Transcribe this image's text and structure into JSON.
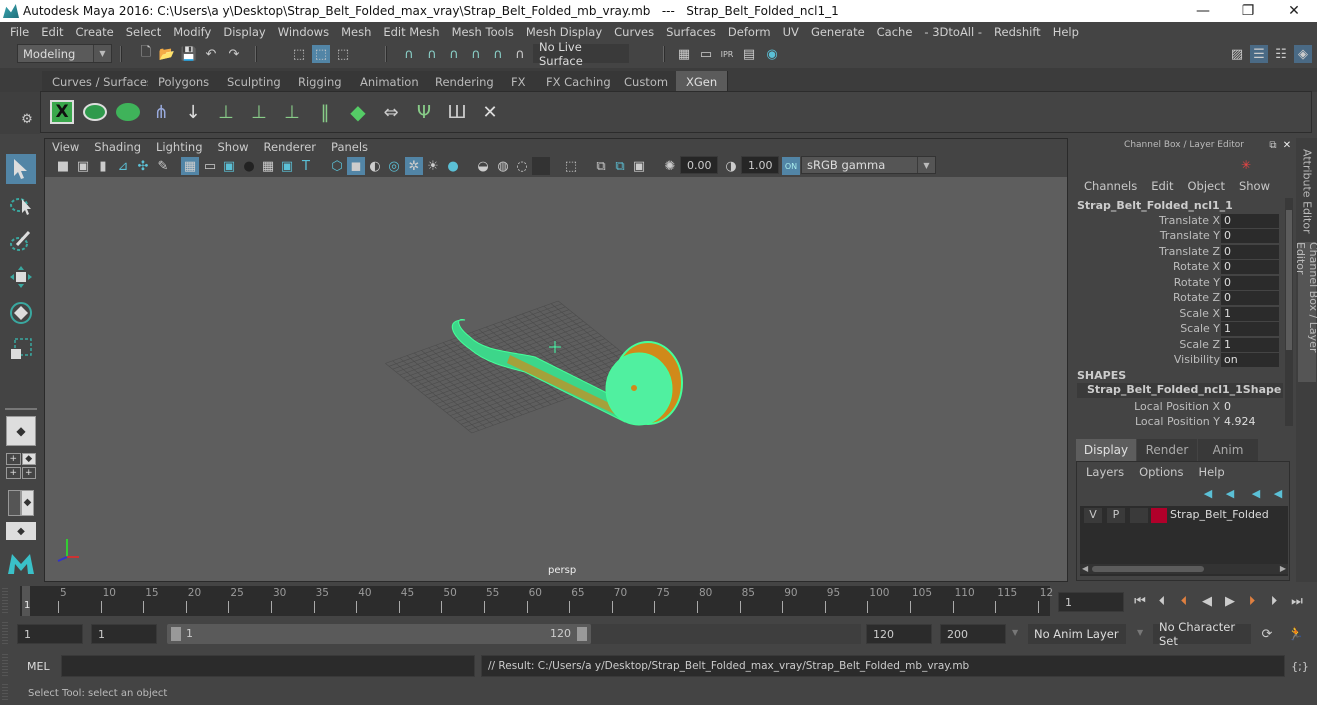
{
  "window": {
    "title": "Autodesk Maya 2016: C:\\Users\\a y\\Desktop\\Strap_Belt_Folded_max_vray\\Strap_Belt_Folded_mb_vray.mb   ---   Strap_Belt_Folded_ncl1_1",
    "minimize": "—",
    "maximize": "❐",
    "close": "✕"
  },
  "menubar": [
    "File",
    "Edit",
    "Create",
    "Select",
    "Modify",
    "Display",
    "Windows",
    "Mesh",
    "Edit Mesh",
    "Mesh Tools",
    "Mesh Display",
    "Curves",
    "Surfaces",
    "Deform",
    "UV",
    "Generate",
    "Cache",
    "- 3DtoAll -",
    "Redshift",
    "Help"
  ],
  "statusline": {
    "mode": "Modeling",
    "live_surface": "No Live Surface"
  },
  "shelf": {
    "tabs": [
      "Curves / Surfaces",
      "Polygons",
      "Sculpting",
      "Rigging",
      "Animation",
      "Rendering",
      "FX",
      "FX Caching",
      "Custom",
      "XGen"
    ],
    "active_tab": "XGen",
    "icons": [
      "xgen-editor-icon",
      "preview-icon",
      "clear-preview-icon",
      "add-primitives-icon",
      "place-guides-icon",
      "add-guide-icon",
      "sculpt-guide-icon",
      "lock-guide-icon",
      "guides-to-curves-icon",
      "create-patches-icon",
      "move-guides-icon",
      "select-guides-icon",
      "guide-bounds-icon",
      "delete-guides-icon"
    ]
  },
  "viewport": {
    "menu": [
      "View",
      "Shading",
      "Lighting",
      "Show",
      "Renderer",
      "Panels"
    ],
    "exposure": "0.00",
    "gamma": "1.00",
    "color_space": "sRGB gamma",
    "camera_label": "persp"
  },
  "channelbox": {
    "header": "Channel Box / Layer Editor",
    "menu": [
      "Channels",
      "Edit",
      "Object",
      "Show"
    ],
    "object_name": "Strap_Belt_Folded_ncl1_1",
    "channels": [
      {
        "label": "Translate X",
        "value": "0"
      },
      {
        "label": "Translate Y",
        "value": "0"
      },
      {
        "label": "Translate Z",
        "value": "0"
      },
      {
        "label": "Rotate X",
        "value": "0"
      },
      {
        "label": "Rotate Y",
        "value": "0"
      },
      {
        "label": "Rotate Z",
        "value": "0"
      },
      {
        "label": "Scale X",
        "value": "1"
      },
      {
        "label": "Scale Y",
        "value": "1"
      },
      {
        "label": "Scale Z",
        "value": "1"
      },
      {
        "label": "Visibility",
        "value": "on"
      }
    ],
    "shapes_header": "SHAPES",
    "shape_name": "Strap_Belt_Folded_ncl1_1Shape",
    "shape_channels": [
      {
        "label": "Local Position X",
        "value": "0"
      },
      {
        "label": "Local Position Y",
        "value": "4.924"
      }
    ]
  },
  "layereditor": {
    "tabs": [
      "Display",
      "Render",
      "Anim"
    ],
    "active_tab": "Display",
    "menu": [
      "Layers",
      "Options",
      "Help"
    ],
    "layers": [
      {
        "v": "V",
        "p": "P",
        "color": "#b0002a",
        "name": "Strap_Belt_Folded"
      }
    ]
  },
  "side_tabs": [
    "Attribute Editor",
    "Channel Box / Layer Editor"
  ],
  "timeslider": {
    "ticks": [
      "5",
      "10",
      "15",
      "20",
      "25",
      "30",
      "35",
      "40",
      "45",
      "50",
      "55",
      "60",
      "65",
      "70",
      "75",
      "80",
      "85",
      "90",
      "95",
      "100",
      "105",
      "110",
      "115",
      "12"
    ],
    "current_frame_marker": "1",
    "current_frame": "1",
    "playback": [
      "go-to-start",
      "step-back-frame",
      "step-back-key",
      "play-backwards",
      "play-forwards",
      "step-forward-key",
      "step-forward-frame",
      "go-to-end"
    ]
  },
  "range": {
    "start": "1",
    "playback_start": "1",
    "slider_start": "1",
    "slider_end": "120",
    "playback_end": "120",
    "end": "200",
    "anim_layer": "No Anim Layer",
    "character_set": "No Character Set"
  },
  "cmdline": {
    "language": "MEL",
    "input": "",
    "result": "// Result: C:/Users/a y/Desktop/Strap_Belt_Folded_max_vray/Strap_Belt_Folded_mb_vray.mb"
  },
  "helpline": "Select Tool: select an object",
  "colors": {
    "accent": "#5285a6",
    "wireframe_selected": "#44ff99",
    "face_highlight": "#d08a1a",
    "layer_color": "#b0002a",
    "active_tab": "#5b5b5b"
  }
}
